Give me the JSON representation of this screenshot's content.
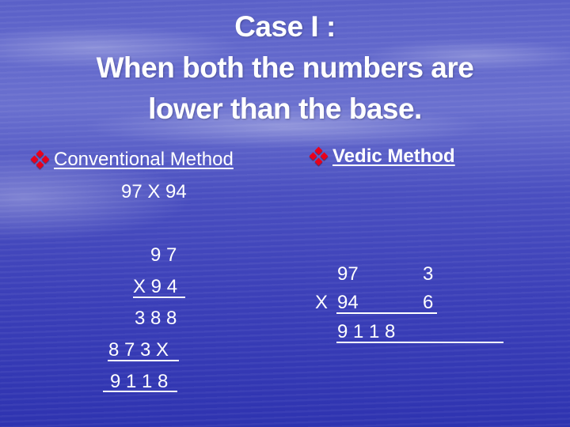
{
  "title": {
    "line1": "Case I :",
    "line2": "When both the numbers are",
    "line3": "lower than the base."
  },
  "conventional": {
    "bullet_icon": "red-diamond-bullet-icon",
    "heading": "Conventional Method",
    "problem": "97 X 94",
    "steps": {
      "multiplicand": "9 7",
      "multiplier": "X 9 4",
      "partial1": "3 8 8",
      "partial2": "8 7 3 X",
      "result": "9 1 1 8"
    }
  },
  "vedic": {
    "bullet_icon": "red-diamond-bullet-icon",
    "heading": "Vedic Method",
    "row1_number": "97",
    "row1_deficit": "3",
    "row2_sign": "X",
    "row2_number": "94",
    "row2_deficit": "6",
    "result": "9 1 1 8"
  },
  "colors": {
    "text": "#ffffff",
    "bullet": "#e8001c",
    "background": "#3b3fb8"
  }
}
